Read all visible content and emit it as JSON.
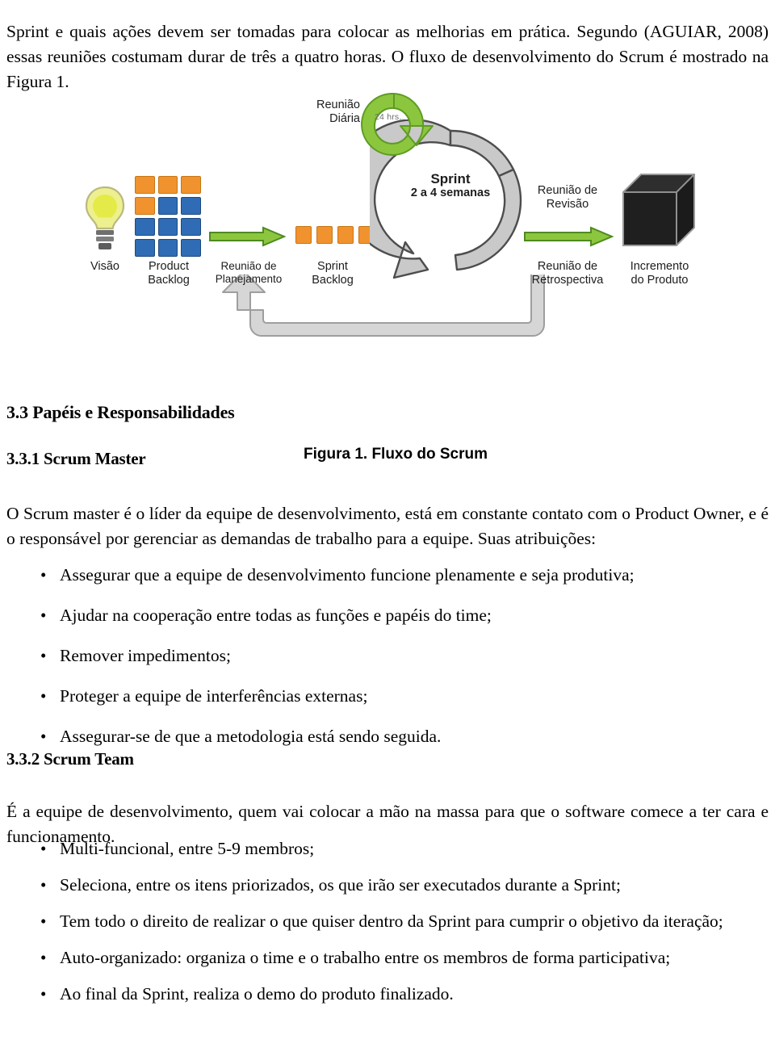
{
  "document": {
    "intro_paragraph": "Sprint e quais ações devem ser tomadas para colocar as melhorias em prática. Segundo (AGUIAR, 2008) essas reuniões costumam durar de três a quatro horas. O fluxo de desenvolvimento do Scrum é mostrado na Figura 1.",
    "figure": {
      "caption": "Figura 1. Fluxo do Scrum",
      "labels": {
        "vision": "Visão",
        "product_backlog": "Product\nBacklog",
        "product_backlog_l1": "Product",
        "product_backlog_l2": "Backlog",
        "planning_meeting_l1": "Reunião de",
        "planning_meeting_l2": "Planejamento",
        "sprint_backlog_l1": "Sprint",
        "sprint_backlog_l2": "Backlog",
        "daily_meeting_l1": "Reunião",
        "daily_meeting_l2": "Diária",
        "daily_duration": "24 hrs.",
        "sprint_title": "Sprint",
        "sprint_duration": "2 a 4 semanas",
        "review_meeting_l1": "Reunião de",
        "review_meeting_l2": "Revisão",
        "retrospective_meeting_l1": "Reunião de",
        "retrospective_meeting_l2": "Retrospectiva",
        "increment_l1": "Incremento",
        "increment_l2": "do Produto"
      },
      "colors": {
        "backlog_item_orange": "#f0932f",
        "backlog_item_blue": "#2f6cb5",
        "arrow_green_fill": "#8cc63e",
        "arrow_green_stroke": "#4e8a1f",
        "sprint_circle_fill": "#c9c9c9",
        "sprint_circle_stroke": "#4d4d4d",
        "feedback_loop_fill": "#d6d6d6",
        "increment_cube": "#1f1f1f",
        "bulb_yellow": "#e8ec5a"
      },
      "product_backlog_grid": [
        [
          "orange",
          "orange",
          "orange"
        ],
        [
          "orange",
          "blue",
          "blue"
        ],
        [
          "blue",
          "blue",
          "blue"
        ],
        [
          "blue",
          "blue",
          "blue"
        ]
      ],
      "sprint_backlog_items": [
        "orange",
        "orange",
        "orange",
        "orange"
      ]
    },
    "sections": [
      {
        "id": "3.3",
        "heading": "3.3 Papéis e Responsabilidades"
      },
      {
        "id": "3.3.1",
        "heading": "3.3.1 Scrum Master",
        "paragraph": "O Scrum master é o líder da equipe de desenvolvimento, está em constante contato com o Product Owner, e é o responsável por gerenciar as demandas de trabalho para a equipe. Suas atribuições:",
        "bullets": [
          "Assegurar que a equipe de desenvolvimento funcione plenamente e seja produtiva;",
          "Ajudar na cooperação entre todas as funções e papéis do time;",
          "Remover impedimentos;",
          "Proteger a equipe de interferências externas;",
          "Assegurar-se de que a metodologia está sendo seguida."
        ]
      },
      {
        "id": "3.3.2",
        "heading": "3.3.2 Scrum Team",
        "paragraph": "É a equipe de desenvolvimento, quem vai colocar a mão na massa para que o software comece a ter cara e funcionamento.",
        "bullets": [
          "Multi-funcional, entre 5-9 membros;",
          "Seleciona, entre os itens priorizados, os que irão ser executados durante a Sprint;",
          "Tem todo o direito de realizar o que quiser dentro da Sprint para cumprir o objetivo da iteração;",
          "Auto-organizado: organiza o time e o trabalho entre os membros de forma participativa;",
          "Ao final da Sprint, realiza o demo do produto finalizado."
        ]
      }
    ],
    "bullet_glyph": "•"
  }
}
